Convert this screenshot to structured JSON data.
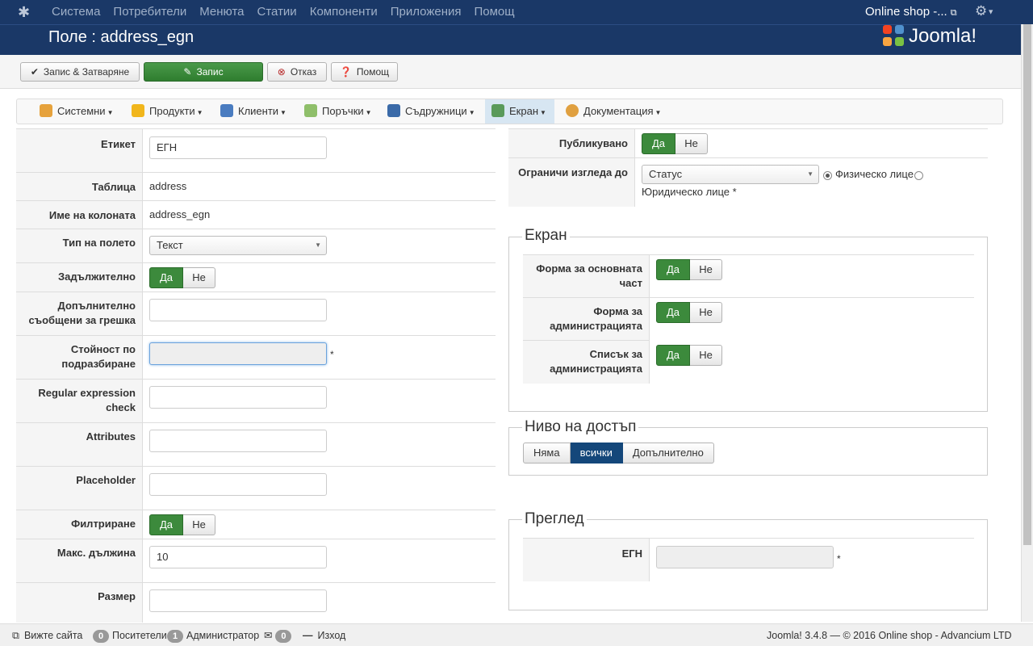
{
  "topnav": {
    "menu": [
      "Система",
      "Потребители",
      "Менюта",
      "Статии",
      "Компоненти",
      "Приложения",
      "Помощ"
    ],
    "site_label": "Online shop -..."
  },
  "header": {
    "title": "Поле : address_egn",
    "brand": "Joomla!"
  },
  "toolbar": {
    "save_close": "Запис & Затваряне",
    "save": "Запис",
    "cancel": "Отказ",
    "help": "Помощ"
  },
  "component_menu": [
    "Системни",
    "Продукти",
    "Клиенти",
    "Поръчки",
    "Съдружници",
    "Екран",
    "Документация"
  ],
  "form": {
    "label_label": "Етикет",
    "label_value": "ЕГН",
    "table_label": "Таблица",
    "table_value": "address",
    "column_label": "Име на колоната",
    "column_value": "address_egn",
    "type_label": "Тип на полето",
    "type_value": "Текст",
    "required_label": "Задължително",
    "errmsg_label": "Допълнително съобщени за грешка",
    "default_label": "Стойност по подразбиране",
    "regex_label": "Regular expression check",
    "attributes_label": "Attributes",
    "placeholder_label": "Placeholder",
    "filter_label": "Филтриране",
    "maxlen_label": "Макс. дължина",
    "maxlen_value": "10",
    "size_label": "Размер",
    "yes": "Да",
    "no": "Не",
    "required_mark": "*"
  },
  "right": {
    "published_label": "Публикувано",
    "restrict_label": "Ограничи изгледа до",
    "restrict_select": "Статус",
    "radio1": "Физическо лице",
    "radio2": "Юридическо лице *",
    "display_legend": "Екран",
    "front_label": "Форма за основната част",
    "admin_form_label": "Форма за администрацията",
    "admin_list_label": "Списък за администрацията",
    "access_legend": "Ниво на достъп",
    "access_options": [
      "Няма",
      "всички",
      "Допълнително"
    ],
    "preview_legend": "Преглед",
    "preview_label": "ЕГН"
  },
  "status": {
    "view_site": "Вижте сайта",
    "visitors_count": "0",
    "visitors": "Поситетели",
    "admins_count": "1",
    "admins": "Администратор",
    "msgs_count": "0",
    "logout": "Изход",
    "footer": "Joomla! 3.4.8  —  © 2016 Online shop - Advancium LTD"
  }
}
